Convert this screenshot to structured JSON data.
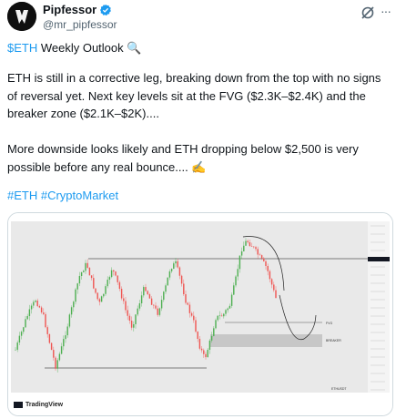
{
  "author": {
    "name": "Pipfessor",
    "handle": "@mr_pipfessor"
  },
  "tweet": {
    "cashtag": "$ETH",
    "title_rest": " Weekly Outlook ",
    "title_emoji": "🔍",
    "para1": "ETH is still in a corrective leg, breaking down from the top with no signs of reversal yet. Next key levels sit at the FVG ($2.3K–$2.4K) and the breaker zone ($2.1K–$2K)....",
    "para2": "More downside looks likely and ETH dropping below $2,500 is very possible before any real bounce.... ",
    "para2_emoji": "✍️",
    "hashtags": [
      "#ETH",
      "#CryptoMarket"
    ]
  },
  "chart": {
    "provider": "TradingView",
    "symbol": "ETHUSDT",
    "fvg_label": "FVG",
    "breaker_label": "BREAKER"
  },
  "colors": {
    "link": "#1d9bf0",
    "verified": "#1d9bf0",
    "candle_up": "#4caf50",
    "candle_down": "#ef5350",
    "chart_bg": "#e9e9e9"
  }
}
